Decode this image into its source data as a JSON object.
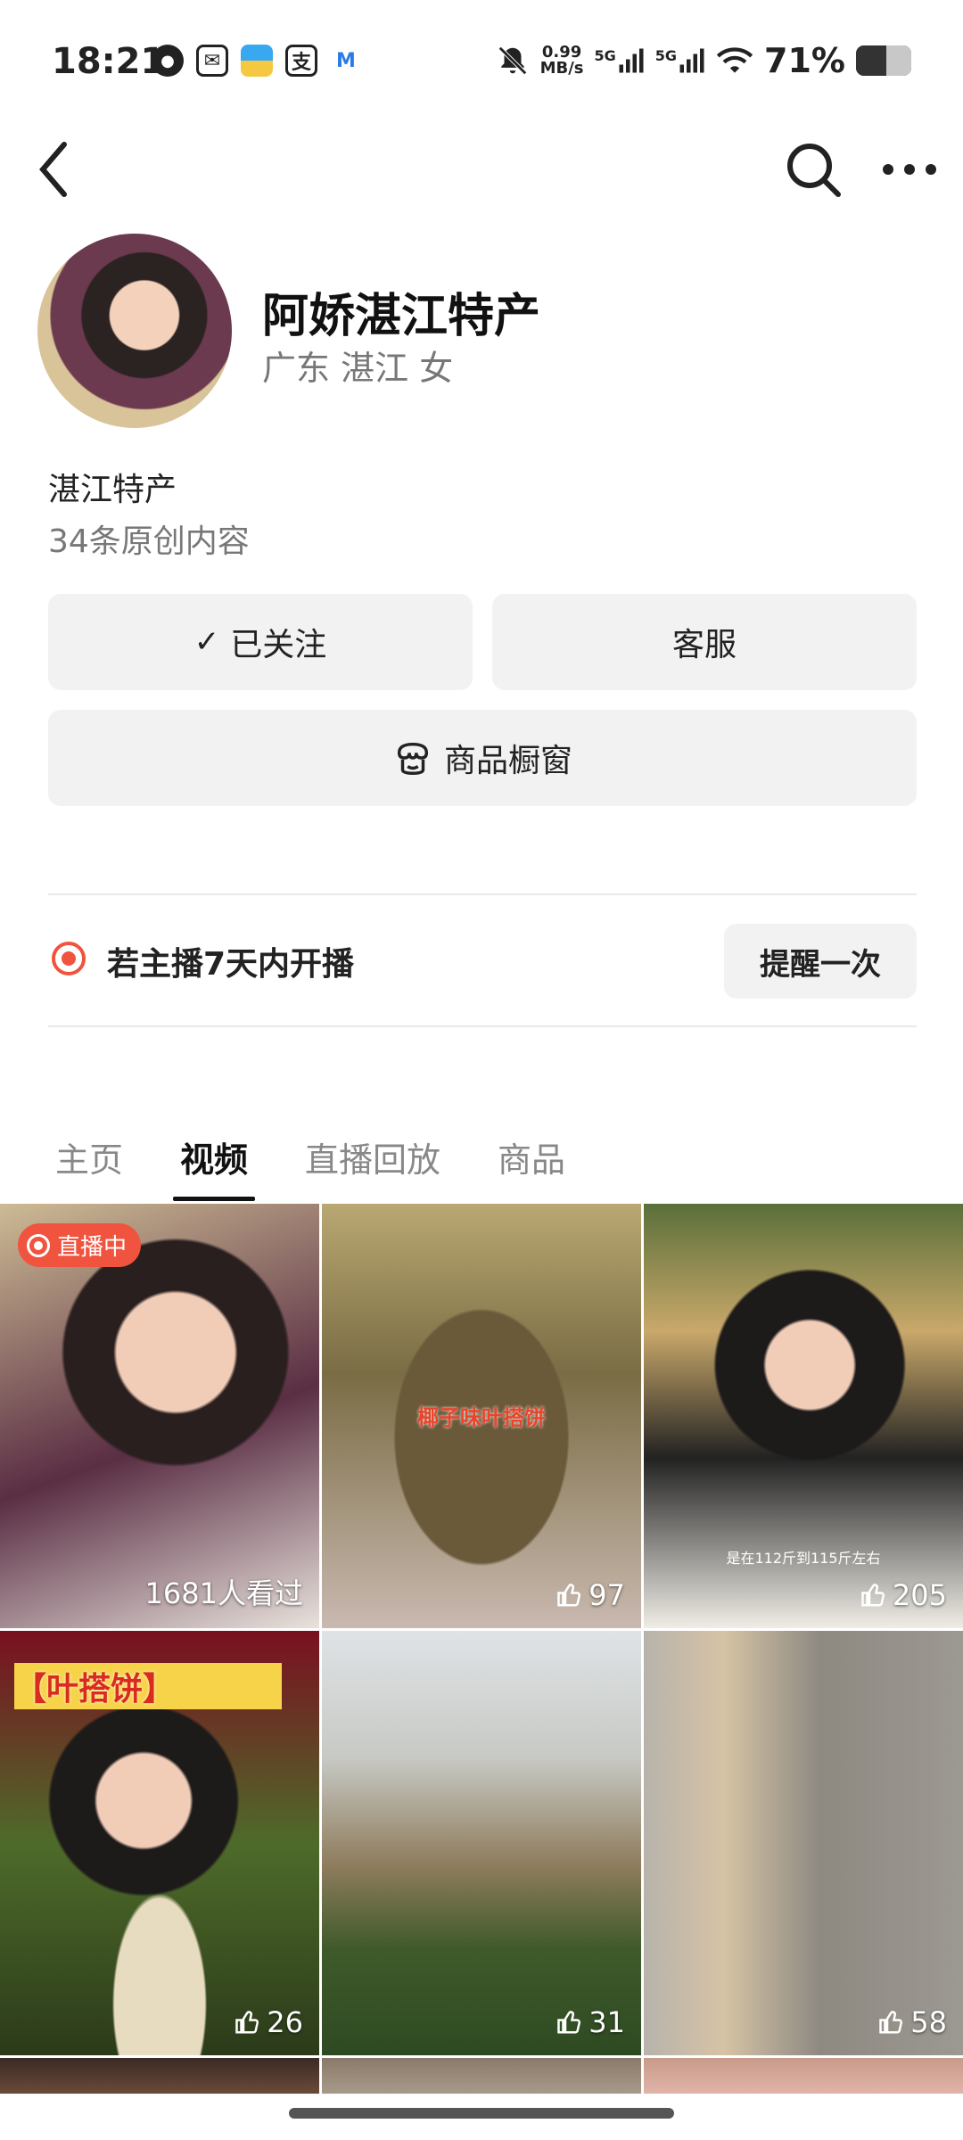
{
  "status_bar": {
    "time": "18:21",
    "net_speed_value": "0.99",
    "net_speed_unit": "MB/s",
    "sig1": "5G",
    "sig2": "5G",
    "battery": "71%"
  },
  "profile": {
    "name": "阿娇湛江特产",
    "location": "广东 湛江 女",
    "bio": "湛江特产",
    "content_count": "34条原创内容"
  },
  "actions": {
    "follow_label": "已关注",
    "service_label": "客服",
    "shop_label": "商品橱窗"
  },
  "live_reminder": {
    "text": "若主播7天内开播",
    "button": "提醒一次"
  },
  "tabs": [
    {
      "label": "主页",
      "active": false
    },
    {
      "label": "视频",
      "active": true
    },
    {
      "label": "直播回放",
      "active": false
    },
    {
      "label": "商品",
      "active": false
    }
  ],
  "videos": [
    {
      "badge": "直播中",
      "stat": "1681人看过",
      "caption": ""
    },
    {
      "stat": "97",
      "caption": "椰子味叶搭饼"
    },
    {
      "stat": "205",
      "caption": "是在112斤到115斤左右"
    },
    {
      "stat": "26",
      "caption": "【叶搭饼】"
    },
    {
      "stat": "31",
      "caption": ""
    },
    {
      "stat": "58",
      "caption": ""
    }
  ],
  "icons": {
    "back": "chevron-left-icon",
    "search": "search-icon",
    "more": "more-icon",
    "check": "check-icon",
    "shop": "shop-icon",
    "like": "thumbs-up-icon"
  },
  "colors": {
    "accent": "#f0533e",
    "button_bg": "#f2f2f2"
  }
}
